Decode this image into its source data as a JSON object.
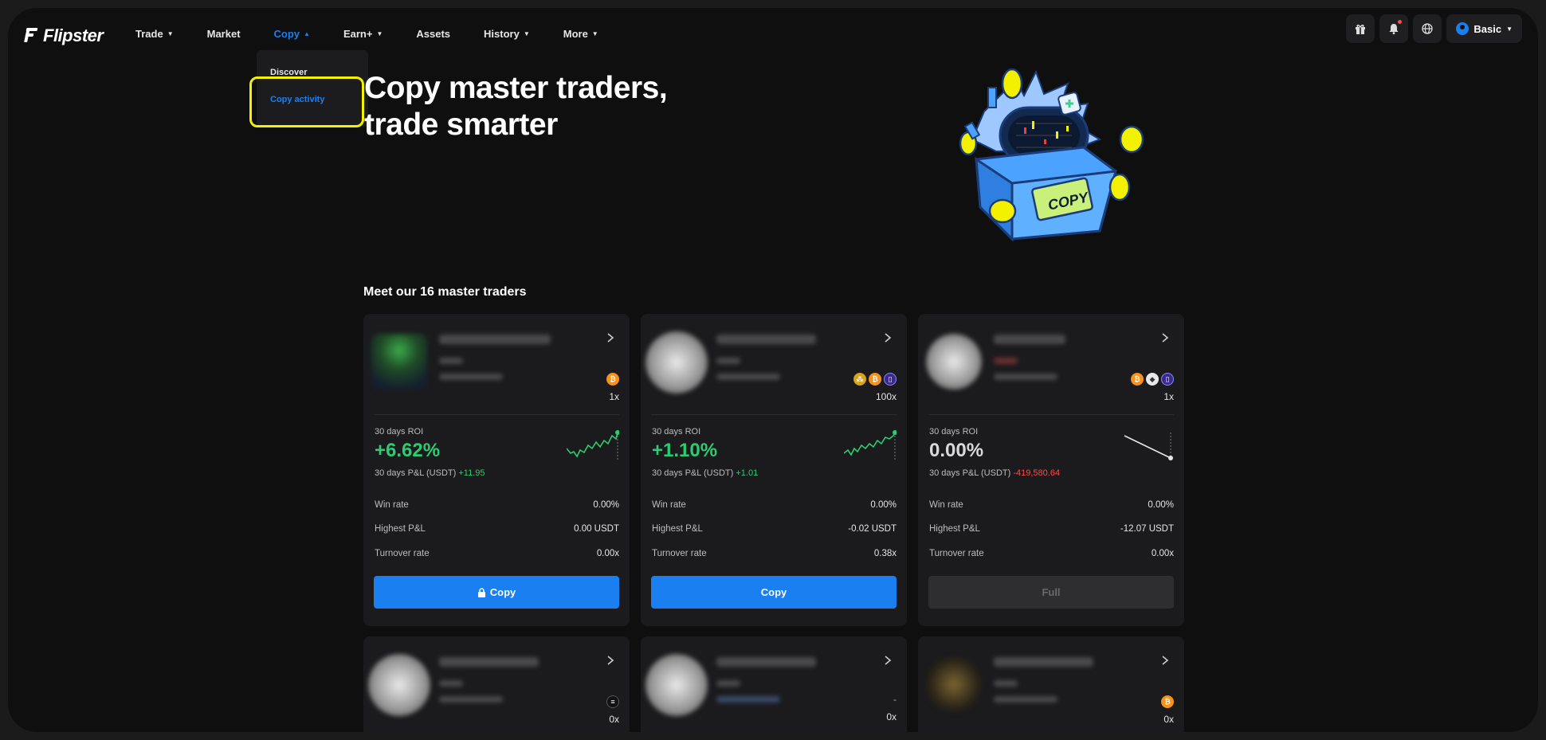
{
  "brand": {
    "name": "Flipster"
  },
  "nav": {
    "items": [
      {
        "label": "Trade",
        "caret": true
      },
      {
        "label": "Market",
        "caret": false
      },
      {
        "label": "Copy",
        "caret": true,
        "active": true
      },
      {
        "label": "Earn+",
        "caret": true
      },
      {
        "label": "Assets",
        "caret": false
      },
      {
        "label": "History",
        "caret": true
      },
      {
        "label": "More",
        "caret": true
      }
    ],
    "right": {
      "user_label": "Basic"
    }
  },
  "dropdown": {
    "items": [
      "Discover",
      "Copy activity"
    ],
    "selected": "Copy activity"
  },
  "hero": {
    "title_line1": "Copy master traders,",
    "title_line2": "trade smarter",
    "art_label": "COPY"
  },
  "section": {
    "title": "Meet our 16 master traders"
  },
  "cards": [
    {
      "leverage": "1x",
      "coins": [
        "btc"
      ],
      "roi_label": "30 days ROI",
      "roi": "+6.62%",
      "pnl_label": "30 days P&L (USDT)",
      "pnl": "+11.95",
      "pnl_sign": "pos",
      "stats": [
        {
          "label": "Win rate",
          "value": "0.00%"
        },
        {
          "label": "Highest P&L",
          "value": "0.00 USDT"
        },
        {
          "label": "Turnover rate",
          "value": "0.00x"
        }
      ],
      "button": "Copy",
      "button_locked": true
    },
    {
      "leverage": "100x",
      "coins": [
        "mix",
        "btc",
        "ton"
      ],
      "roi_label": "30 days ROI",
      "roi": "+1.10%",
      "pnl_label": "30 days P&L (USDT)",
      "pnl": "+1.01",
      "pnl_sign": "pos",
      "stats": [
        {
          "label": "Win rate",
          "value": "0.00%"
        },
        {
          "label": "Highest P&L",
          "value": "-0.02 USDT"
        },
        {
          "label": "Turnover rate",
          "value": "0.38x"
        }
      ],
      "button": "Copy",
      "button_locked": false
    },
    {
      "leverage": "1x",
      "coins": [
        "btc",
        "eth",
        "ton"
      ],
      "roi_label": "30 days ROI",
      "roi": "0.00%",
      "pnl_label": "30 days P&L (USDT)",
      "pnl": "-419,580.64",
      "pnl_sign": "neg",
      "stats": [
        {
          "label": "Win rate",
          "value": "0.00%"
        },
        {
          "label": "Highest P&L",
          "value": "-12.07 USDT"
        },
        {
          "label": "Turnover rate",
          "value": "0.00x"
        }
      ],
      "button": "Full",
      "button_locked": false
    },
    {
      "leverage": "0x",
      "coins": [
        "sol"
      ]
    },
    {
      "leverage": "0x",
      "coins": [],
      "dash": "-"
    },
    {
      "leverage": "0x",
      "coins": [
        "btc"
      ]
    }
  ],
  "colors": {
    "accent": "#1a7ff0",
    "positive": "#2ecc71",
    "negative": "#ff4b4b",
    "highlight": "#f3f000"
  }
}
